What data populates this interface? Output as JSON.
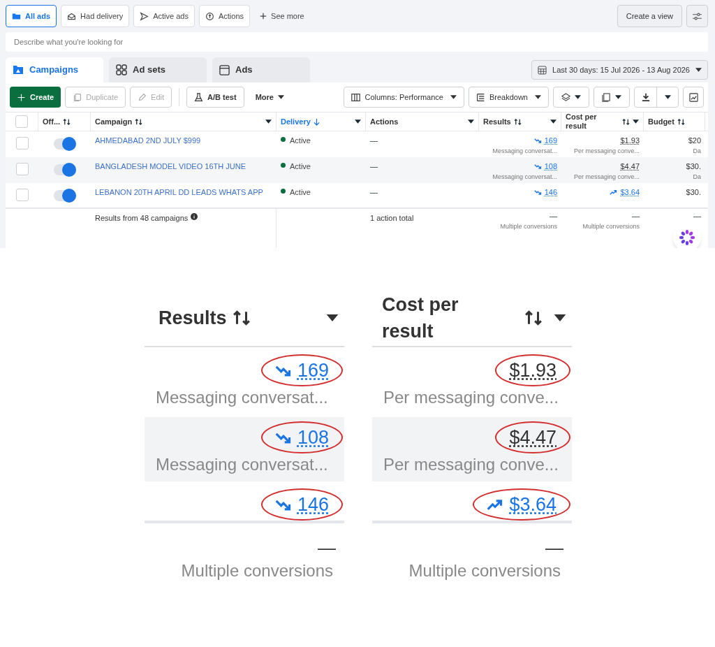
{
  "filters": [
    {
      "label": "All ads",
      "kind": "folder",
      "selected": true
    },
    {
      "label": "Had delivery",
      "kind": "envelope",
      "selected": false
    },
    {
      "label": "Active ads",
      "kind": "send",
      "selected": false
    },
    {
      "label": "Actions",
      "kind": "circle-arrow",
      "selected": false
    }
  ],
  "see_more": "See more",
  "create_view": "Create a view",
  "search": {
    "placeholder": "Describe what you're looking for"
  },
  "level_tabs": [
    {
      "label": "Campaigns",
      "kind": "campaign",
      "selected": true
    },
    {
      "label": "Ad sets",
      "kind": "grid",
      "selected": false
    },
    {
      "label": "Ads",
      "kind": "window",
      "selected": false
    }
  ],
  "date_range": "Last 30 days: 15 Jul 2026 - 13 Aug 2026",
  "toolbar": [
    {
      "label": "Create",
      "kind": "primary",
      "disabled": false
    },
    {
      "label": "Duplicate",
      "kind": "copy",
      "disabled": true
    },
    {
      "label": "Edit",
      "kind": "pencil",
      "disabled": true
    },
    {
      "label": "A/B test",
      "kind": "flask",
      "disabled": false
    },
    {
      "label": "More",
      "kind": "menu",
      "disabled": false
    }
  ],
  "toolbar_right": [
    {
      "label": "Columns: Performance",
      "kind": "columns"
    },
    {
      "label": "Breakdown",
      "kind": "breakdown"
    }
  ],
  "table": {
    "select_all_checked": false,
    "columns": [
      "Off...",
      "Campaign",
      "Delivery",
      "Actions",
      "Results",
      "Cost per result",
      "Budget"
    ],
    "rows": [
      {
        "checked": false,
        "on": true,
        "campaign": "AHMEDABAD 2ND JULY $999",
        "delivery": "Active",
        "actions": "—",
        "results": {
          "text": "169",
          "kind": "down"
        },
        "results_sub": "Messaging conversat...",
        "cost": {
          "text": "$1.93",
          "kind": "plain"
        },
        "cost_sub": "Per messaging conve...",
        "budget": "$20",
        "budget_sub": "Da"
      },
      {
        "checked": false,
        "on": true,
        "campaign": "BANGLADESH MODEL VIDEO 16TH JUNE",
        "delivery": "Active",
        "actions": "—",
        "results": {
          "text": "108",
          "kind": "down"
        },
        "results_sub": "Messaging conversat...",
        "cost": {
          "text": "$4.47",
          "kind": "plain"
        },
        "cost_sub": "Per messaging conve...",
        "budget": "$30.",
        "budget_sub": "Da"
      },
      {
        "checked": false,
        "on": true,
        "campaign": "LEBANON 20TH APRIL DD LEADS WHATS APP",
        "delivery": "Active",
        "actions": "—",
        "results": {
          "text": "146",
          "kind": "down"
        },
        "cost": {
          "text": "$3.64",
          "kind": "up"
        },
        "budget": "$30."
      }
    ],
    "footer": {
      "campaign": "Results from 48 campaigns",
      "actions": "1 action total",
      "results": "—",
      "results_sub": "Multiple conversions",
      "cost": "—",
      "cost_sub": "Multiple conversions",
      "budget": "—"
    }
  },
  "zoom": {
    "columns": [
      "Results",
      "Cost per result"
    ],
    "rows": [
      {
        "results": {
          "text": "169",
          "kind": "down"
        },
        "results_sub": "Messaging conversat...",
        "cost": {
          "text": "$1.93",
          "kind": "plain"
        },
        "cost_sub": "Per messaging conve..."
      },
      {
        "results": {
          "text": "108",
          "kind": "down"
        },
        "results_sub": "Messaging conversat...",
        "cost": {
          "text": "$4.47",
          "kind": "plain"
        },
        "cost_sub": "Per messaging conve..."
      },
      {
        "results": {
          "text": "146",
          "kind": "down"
        },
        "cost": {
          "text": "$3.64",
          "kind": "up"
        }
      }
    ],
    "footer": {
      "results": "—",
      "results_sub": "Multiple conversions",
      "cost": "—",
      "cost_sub": "Multiple conversions"
    }
  }
}
